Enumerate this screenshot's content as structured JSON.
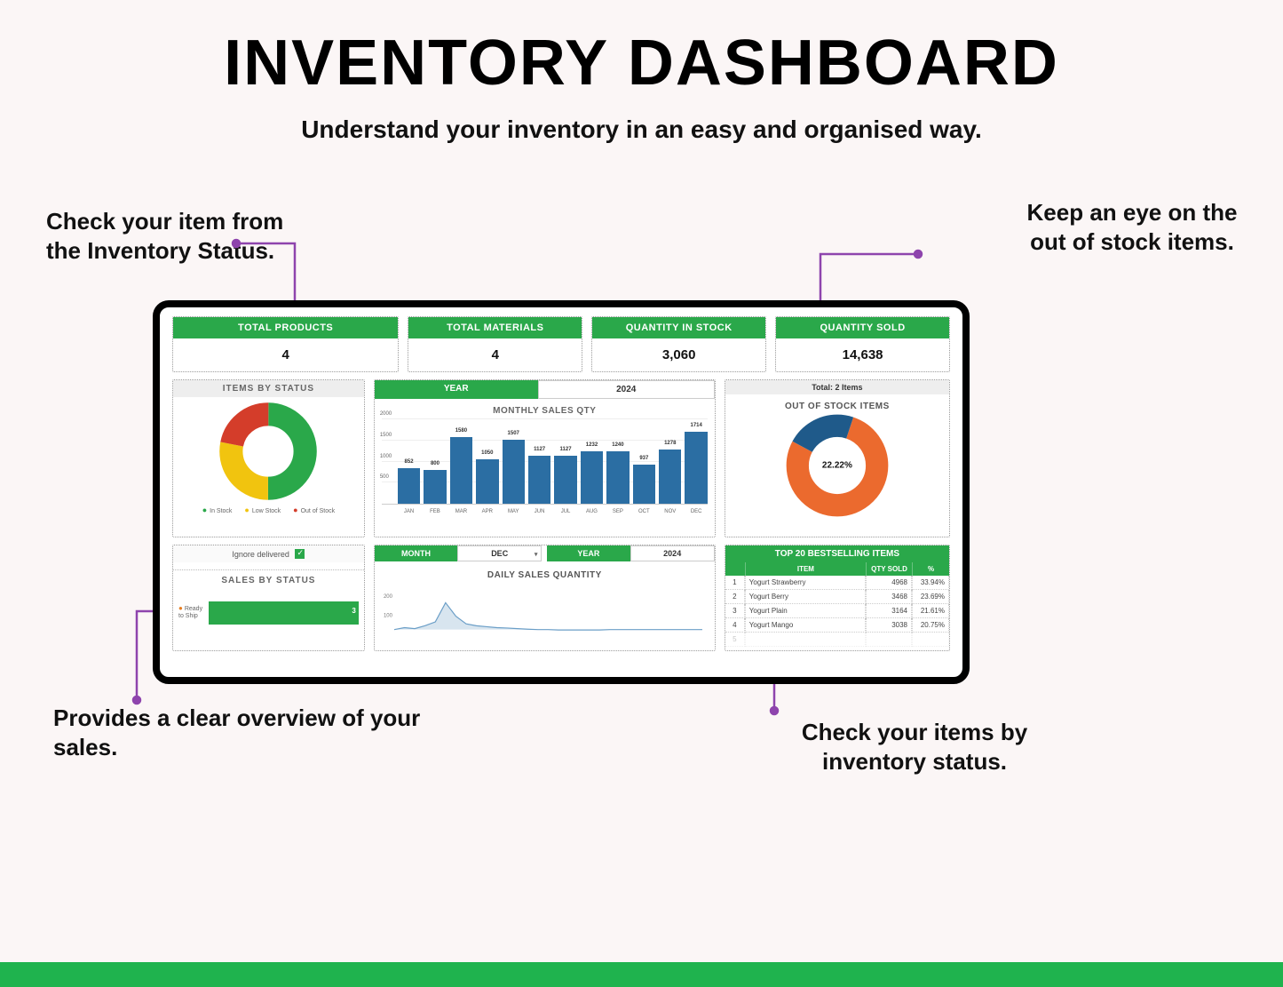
{
  "page": {
    "title": "INVENTORY DASHBOARD",
    "subtitle": "Understand your inventory in an easy and organised way."
  },
  "callouts": {
    "top_left": "Check your item from the Inventory Status.",
    "top_right": "Keep an eye on the out of stock items.",
    "bottom_left": "Provides a clear overview of your sales.",
    "bottom_right": "Check your items by inventory status."
  },
  "colors": {
    "green": "#2aa84a",
    "blue_bar": "#2b6ea3",
    "yellow": "#f1c40f",
    "red": "#d43d2a",
    "orange": "#eb6a2e",
    "navy": "#1f5a8a",
    "purple_arrow": "#8e44ad"
  },
  "kpis": [
    {
      "label": "TOTAL PRODUCTS",
      "value": "4"
    },
    {
      "label": "TOTAL MATERIALS",
      "value": "4"
    },
    {
      "label": "QUANTITY IN STOCK",
      "value": "3,060"
    },
    {
      "label": "QUANTITY SOLD",
      "value": "14,638"
    }
  ],
  "items_by_status": {
    "title": "ITEMS BY STATUS",
    "legend": [
      "In Stock",
      "Low Stock",
      "Out of Stock"
    ]
  },
  "monthly_sales": {
    "year_label": "YEAR",
    "year_value": "2024",
    "title": "MONTHLY SALES QTY"
  },
  "out_of_stock": {
    "top": "Total: 2 Items",
    "title": "OUT OF STOCK ITEMS",
    "center": "22.22%"
  },
  "sales_by_status": {
    "ignore_label": "Ignore delivered",
    "ignore_checked": true,
    "title": "SALES BY STATUS",
    "bar_label": "Ready to Ship",
    "bar_value": "3"
  },
  "daily_sales": {
    "month_label": "MONTH",
    "month_value": "DEC",
    "year_label": "YEAR",
    "year_value": "2024",
    "title": "DAILY SALES QUANTITY",
    "y_ticks": [
      "200",
      "100"
    ]
  },
  "bestsellers": {
    "header": "TOP 20 BESTSELLING ITEMS",
    "cols": {
      "item": "ITEM",
      "qty": "QTY SOLD",
      "pct": "%"
    },
    "rows": [
      {
        "i": "1",
        "item": "Yogurt Strawberry",
        "qty": "4968",
        "pct": "33.94%"
      },
      {
        "i": "2",
        "item": "Yogurt Berry",
        "qty": "3468",
        "pct": "23.69%"
      },
      {
        "i": "3",
        "item": "Yogurt Plain",
        "qty": "3164",
        "pct": "21.61%"
      },
      {
        "i": "4",
        "item": "Yogurt Mango",
        "qty": "3038",
        "pct": "20.75%"
      }
    ]
  },
  "chart_data": [
    {
      "id": "items_by_status",
      "type": "pie",
      "title": "ITEMS BY STATUS",
      "categories": [
        "In Stock",
        "Low Stock",
        "Out of Stock"
      ],
      "values": [
        50,
        28,
        22
      ],
      "colors": [
        "#2aa84a",
        "#f1c40f",
        "#d43d2a"
      ],
      "donut": true
    },
    {
      "id": "monthly_sales_qty",
      "type": "bar",
      "title": "MONTHLY SALES QTY",
      "xlabel": "",
      "ylabel": "",
      "ylim": [
        0,
        2000
      ],
      "y_ticks": [
        500,
        1000,
        1500,
        2000
      ],
      "categories": [
        "JAN",
        "FEB",
        "MAR",
        "APR",
        "MAY",
        "JUN",
        "JUL",
        "AUG",
        "SEP",
        "OCT",
        "NOV",
        "DEC"
      ],
      "values": [
        852,
        800,
        1580,
        1050,
        1507,
        1127,
        1127,
        1232,
        1240,
        937,
        1278,
        1714
      ]
    },
    {
      "id": "out_of_stock_items",
      "type": "pie",
      "title": "OUT OF STOCK ITEMS",
      "categories": [
        "Out of Stock",
        "In Stock"
      ],
      "values": [
        22.22,
        77.78
      ],
      "colors": [
        "#1f5a8a",
        "#eb6a2e"
      ],
      "donut": true,
      "center_label": "22.22%"
    },
    {
      "id": "sales_by_status",
      "type": "bar",
      "orientation": "horizontal",
      "title": "SALES BY STATUS",
      "categories": [
        "Ready to Ship"
      ],
      "values": [
        3
      ]
    },
    {
      "id": "daily_sales_quantity",
      "type": "line",
      "title": "DAILY SALES QUANTITY",
      "ylim": [
        0,
        250
      ],
      "y_ticks": [
        100,
        200
      ],
      "x": [
        1,
        2,
        3,
        4,
        5,
        6,
        7,
        8,
        9,
        10,
        11,
        12,
        13,
        14,
        15,
        16,
        17,
        18,
        19,
        20,
        21,
        22,
        23,
        24,
        25,
        26,
        27,
        28,
        29,
        30,
        31
      ],
      "values": [
        20,
        30,
        25,
        40,
        60,
        160,
        90,
        50,
        40,
        35,
        30,
        28,
        25,
        22,
        20,
        20,
        18,
        18,
        18,
        18,
        18,
        20,
        20,
        20,
        20,
        20,
        20,
        20,
        20,
        20,
        20
      ]
    },
    {
      "id": "top_bestsellers",
      "type": "table",
      "title": "TOP 20 BESTSELLING ITEMS",
      "columns": [
        "#",
        "ITEM",
        "QTY SOLD",
        "%"
      ],
      "rows": [
        [
          1,
          "Yogurt Strawberry",
          4968,
          "33.94%"
        ],
        [
          2,
          "Yogurt Berry",
          3468,
          "23.69%"
        ],
        [
          3,
          "Yogurt Plain",
          3164,
          "21.61%"
        ],
        [
          4,
          "Yogurt Mango",
          3038,
          "20.75%"
        ]
      ]
    }
  ]
}
